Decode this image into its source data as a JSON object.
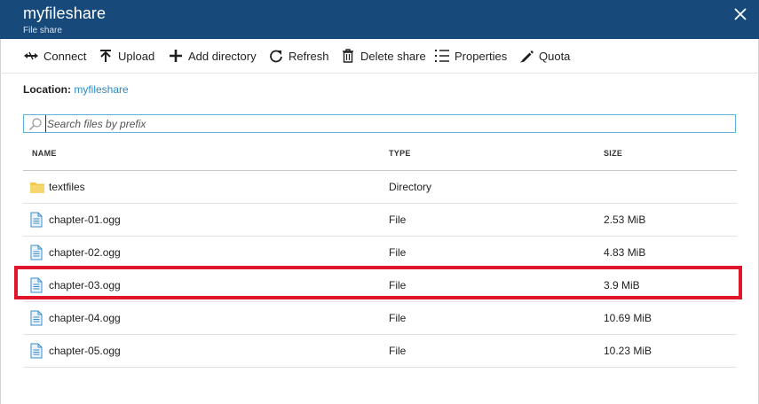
{
  "header": {
    "title": "myfileshare",
    "subtitle": "File share",
    "close_icon": "close-icon"
  },
  "toolbar": {
    "items": [
      {
        "label": "Connect",
        "icon": "connect-icon"
      },
      {
        "label": "Upload",
        "icon": "upload-icon"
      },
      {
        "label": "Add directory",
        "icon": "plus-icon"
      },
      {
        "label": "Refresh",
        "icon": "refresh-icon"
      },
      {
        "label": "Delete share",
        "icon": "trash-icon"
      },
      {
        "label": "Properties",
        "icon": "list-icon"
      },
      {
        "label": "Quota",
        "icon": "pencil-icon"
      }
    ]
  },
  "location": {
    "label": "Location:",
    "value": "myfileshare"
  },
  "search": {
    "placeholder": "Search files by prefix",
    "value": ""
  },
  "table": {
    "columns": [
      "NAME",
      "TYPE",
      "SIZE"
    ],
    "rows": [
      {
        "name": "textfiles",
        "type": "Directory",
        "size": "",
        "icon": "folder-icon"
      },
      {
        "name": "chapter-01.ogg",
        "type": "File",
        "size": "2.53 MiB",
        "icon": "file-icon"
      },
      {
        "name": "chapter-02.ogg",
        "type": "File",
        "size": "4.83 MiB",
        "icon": "file-icon"
      },
      {
        "name": "chapter-03.ogg",
        "type": "File",
        "size": "3.9 MiB",
        "icon": "file-icon"
      },
      {
        "name": "chapter-04.ogg",
        "type": "File",
        "size": "10.69 MiB",
        "icon": "file-icon"
      },
      {
        "name": "chapter-05.ogg",
        "type": "File",
        "size": "10.23 MiB",
        "icon": "file-icon"
      }
    ]
  },
  "colors": {
    "header_bg": "#174a7b",
    "link": "#2a8ac4",
    "highlight": "#e0152b",
    "search_border": "#5fb3d6"
  }
}
